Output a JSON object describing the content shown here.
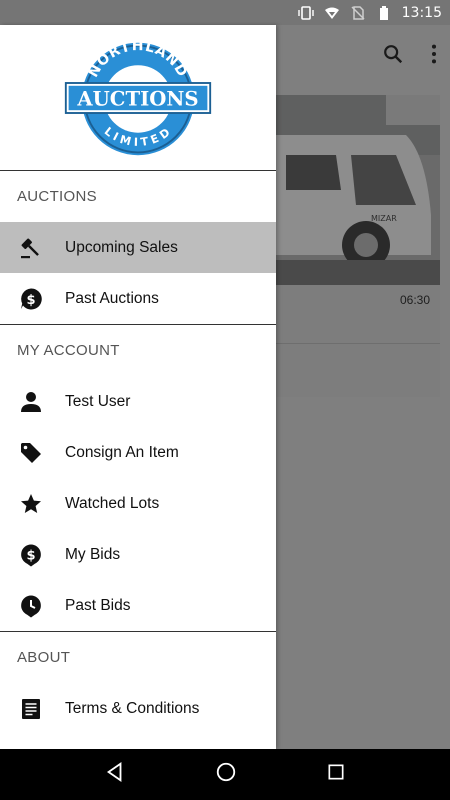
{
  "status_bar": {
    "time": "13:15"
  },
  "background_app": {
    "card_time": "06:30",
    "vehicle_text": "MIZAR"
  },
  "drawer": {
    "logo": {
      "top_text": "NORTHLAND",
      "main_text": "AUCTIONS",
      "bottom_text": "LIMITED",
      "color": "#2a8fd6"
    },
    "sections": [
      {
        "title": "AUCTIONS",
        "items": [
          {
            "label": "Upcoming Sales",
            "icon": "gavel-icon",
            "active": true
          },
          {
            "label": "Past Auctions",
            "icon": "dollar-bubble-icon",
            "active": false
          }
        ]
      },
      {
        "title": "MY ACCOUNT",
        "items": [
          {
            "label": "Test User",
            "icon": "person-icon"
          },
          {
            "label": "Consign An Item",
            "icon": "tag-icon"
          },
          {
            "label": "Watched Lots",
            "icon": "star-icon"
          },
          {
            "label": "My Bids",
            "icon": "dollar-pin-icon"
          },
          {
            "label": "Past Bids",
            "icon": "clock-pin-icon"
          }
        ]
      },
      {
        "title": "ABOUT",
        "items": [
          {
            "label": "Terms & Conditions",
            "icon": "document-icon"
          }
        ]
      }
    ]
  },
  "colors": {
    "active_item_bg": "#bdbdbd",
    "scrim": "#7f7f7f"
  }
}
